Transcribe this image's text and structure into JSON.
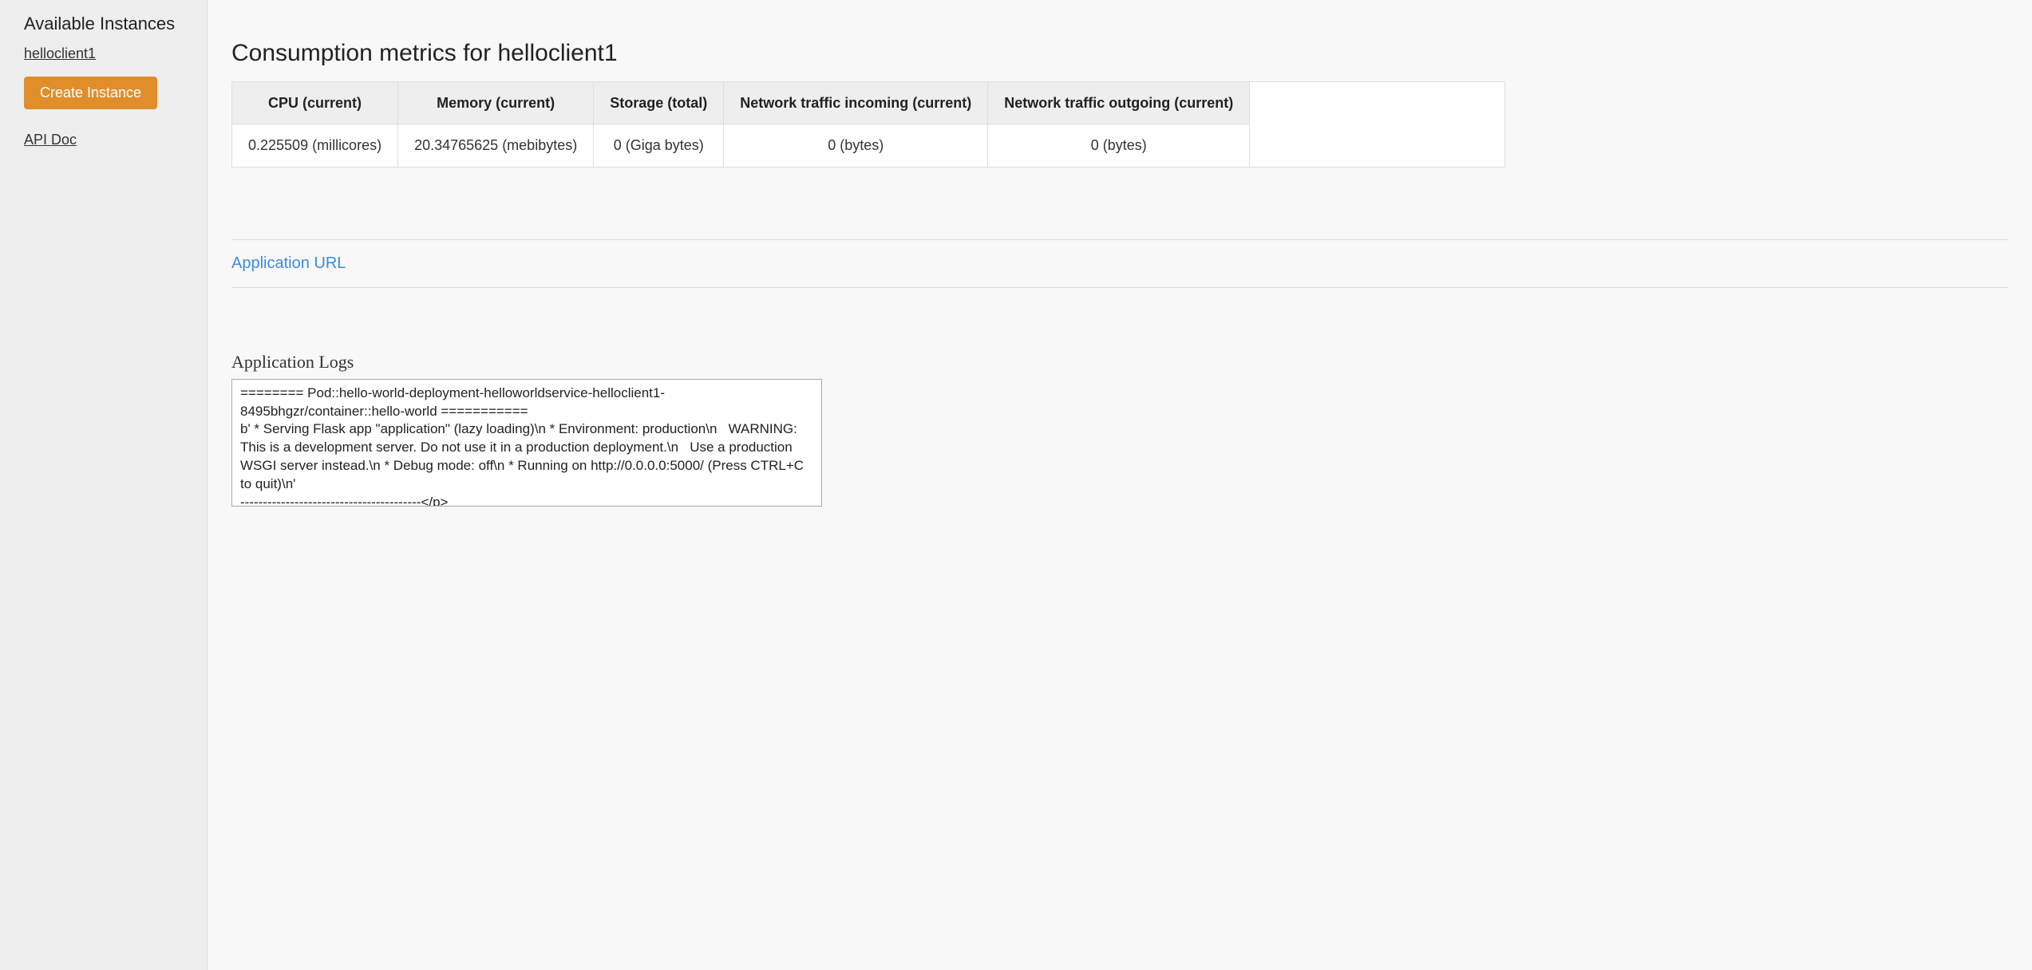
{
  "sidebar": {
    "title": "Available Instances",
    "instances": [
      {
        "label": "helloclient1"
      }
    ],
    "create_label": "Create Instance",
    "api_doc_label": "API Doc"
  },
  "main": {
    "title": "Consumption metrics for helloclient1",
    "metrics": {
      "columns": [
        {
          "header": "CPU (current)",
          "value": "0.225509 (millicores)"
        },
        {
          "header": "Memory (current)",
          "value": "20.34765625 (mebibytes)"
        },
        {
          "header": "Storage (total)",
          "value": "0 (Giga bytes)"
        },
        {
          "header": "Network traffic incoming (current)",
          "value": "0 (bytes)"
        },
        {
          "header": "Network traffic outgoing (current)",
          "value": "0 (bytes)"
        }
      ]
    },
    "app_url_label": "Application URL",
    "logs_heading": "Application Logs",
    "logs_text": "======== Pod::hello-world-deployment-helloworldservice-helloclient1-8495bhgzr/container::hello-world ===========\nb' * Serving Flask app \"application\" (lazy loading)\\n * Environment: production\\n   WARNING: This is a development server. Do not use it in a production deployment.\\n   Use a production WSGI server instead.\\n * Debug mode: off\\n * Running on http://0.0.0.0:5000/ (Press CTRL+C to quit)\\n'\n----------------------------------------</p>"
  }
}
